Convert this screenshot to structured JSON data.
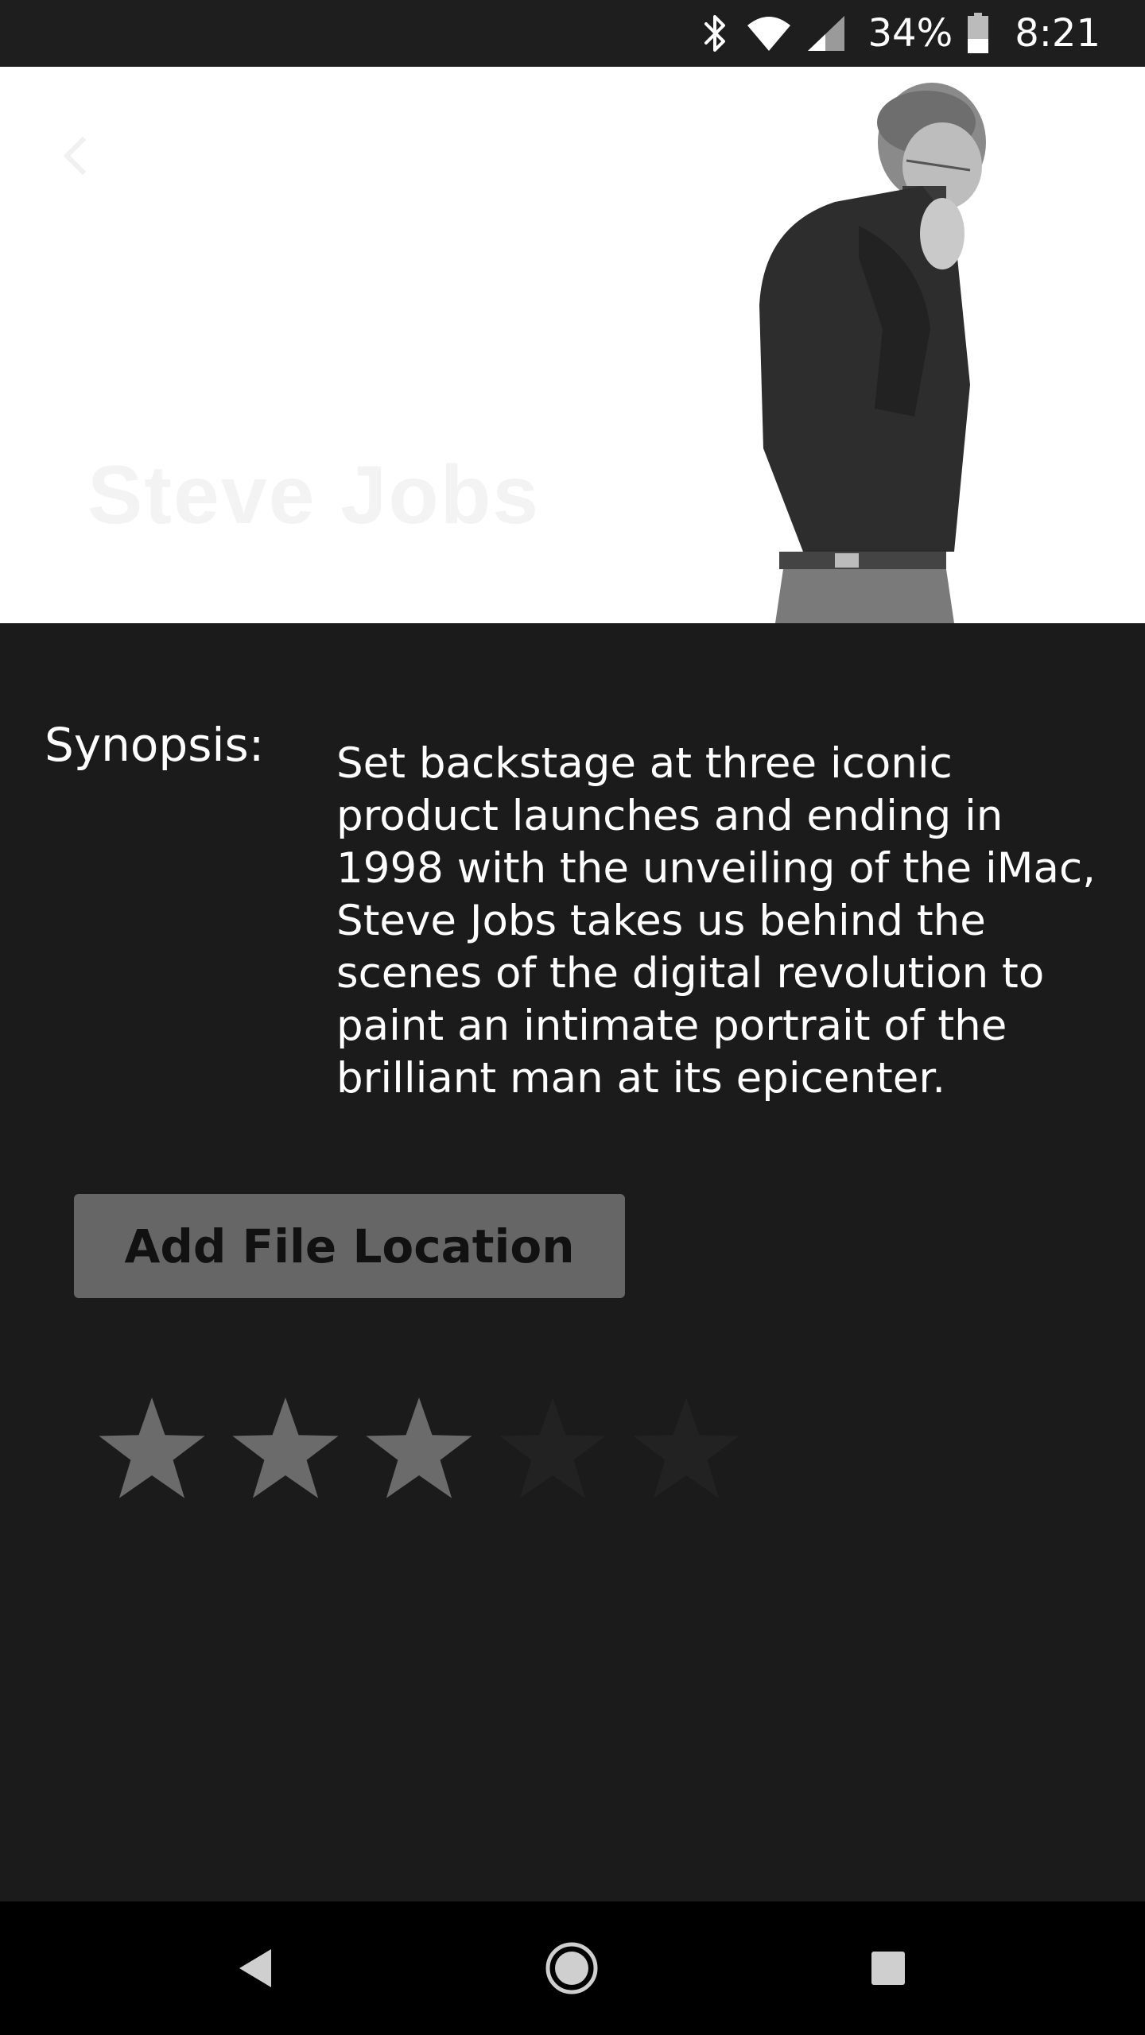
{
  "status_bar": {
    "battery_percent": "34%",
    "time": "8:21",
    "icons": [
      "bluetooth-icon",
      "wifi-icon",
      "cell-signal-icon",
      "battery-icon"
    ]
  },
  "hero": {
    "title": "Steve Jobs",
    "back_icon": "back-arrow-icon"
  },
  "synopsis": {
    "label": "Synopsis:",
    "text": "Set backstage at three iconic product launches and ending in 1998 with the unveiling of the iMac, Steve Jobs takes us behind the scenes of the digital revolution to paint an intimate portrait of the brilliant man at its epicenter."
  },
  "actions": {
    "add_file_location_label": "Add File Location"
  },
  "rating": {
    "value": 3,
    "max": 5,
    "filled_color": "#6b6b6b",
    "empty_color": "#222222"
  },
  "nav_bar": {
    "icons": [
      "nav-back-icon",
      "nav-home-icon",
      "nav-recents-icon"
    ]
  },
  "colors": {
    "background": "#1b1b1b",
    "status_bar": "#1e1e1e",
    "nav_bar": "#000000",
    "button": "#666666"
  }
}
